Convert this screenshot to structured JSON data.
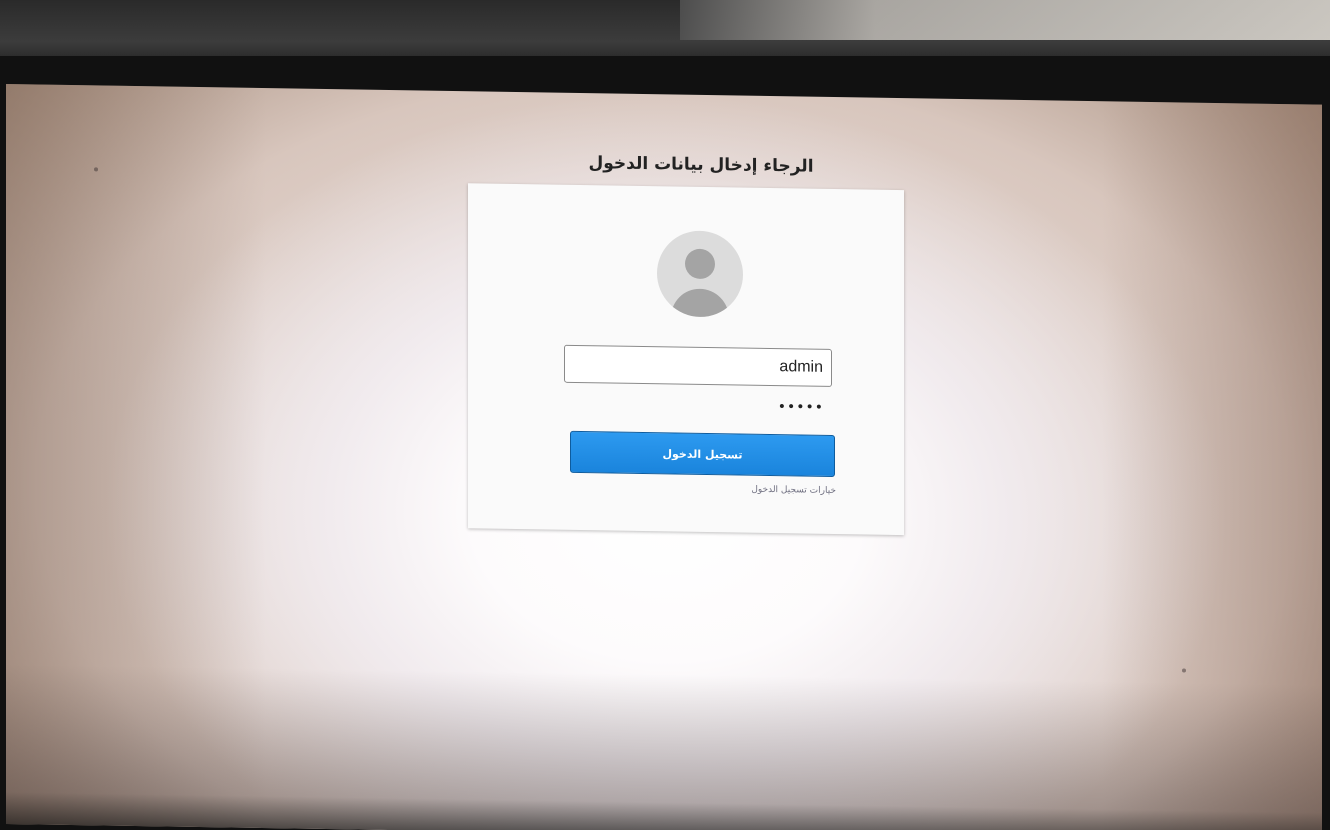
{
  "login": {
    "title": "الرجاء إدخال بيانات الدخول",
    "username_value": "admin",
    "password_value": "•••••",
    "login_button_label": "تسجيل الدخول",
    "options_link_label": "خيارات تسجيل الدخول"
  },
  "icons": {
    "avatar": "user-avatar-icon"
  },
  "colors": {
    "button": "#1a84dc",
    "card": "#fafafa",
    "screen": "#fdfbfc"
  }
}
